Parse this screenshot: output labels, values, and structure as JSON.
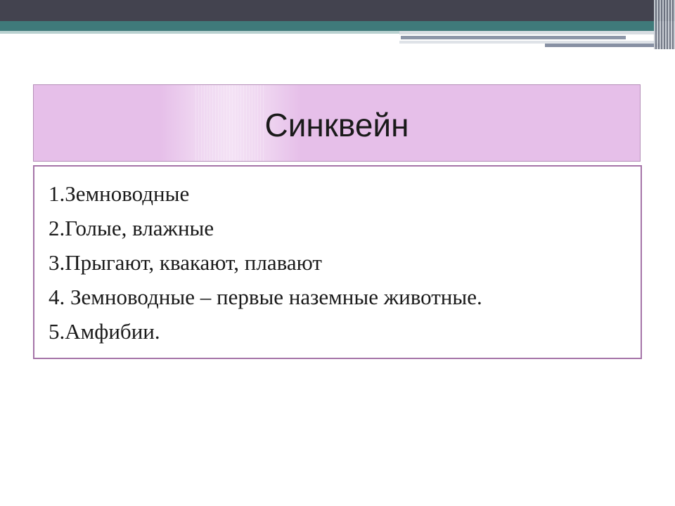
{
  "slide": {
    "title": "Синквейн",
    "items": [
      "1.Земноводные",
      "2.Голые, влажные",
      "3.Прыгают, квакают, плавают",
      "4. Земноводные – первые наземные животные.",
      "5.Амфибии."
    ]
  },
  "colors": {
    "top_band": "#43434f",
    "teal_band": "#3f7a7a",
    "title_fill": "#e6bfe9",
    "content_border": "#a574a8",
    "text": "#1a1a1a"
  }
}
